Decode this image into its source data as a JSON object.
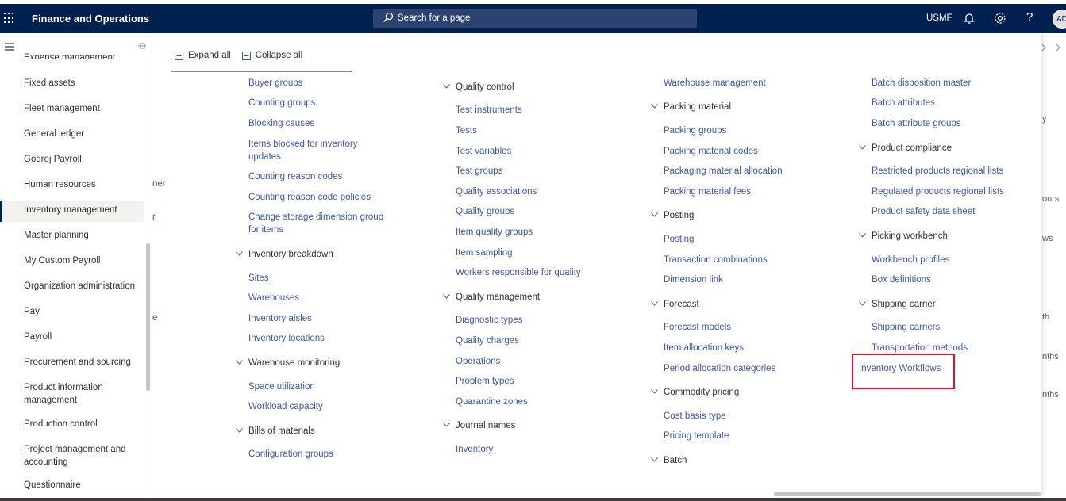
{
  "header": {
    "app_title": "Finance and Operations",
    "search_placeholder": "Search for a page",
    "company": "USMF",
    "help": "?",
    "avatar_initials": "AD"
  },
  "nav": {
    "items": [
      {
        "label": "Expense management"
      },
      {
        "label": "Fixed assets"
      },
      {
        "label": "Fleet management"
      },
      {
        "label": "General ledger"
      },
      {
        "label": "Godrej Payroll"
      },
      {
        "label": "Human resources"
      },
      {
        "label": "Inventory management"
      },
      {
        "label": "Master planning"
      },
      {
        "label": "My Custom Payroll"
      },
      {
        "label": "Organization administration"
      },
      {
        "label": "Pay"
      },
      {
        "label": "Payroll"
      },
      {
        "label": "Procurement and sourcing"
      },
      {
        "label": "Product information management"
      },
      {
        "label": "Production control"
      },
      {
        "label": "Project management and accounting"
      },
      {
        "label": "Questionnaire"
      }
    ]
  },
  "flyout": {
    "expand_all": "Expand all",
    "collapse_all": "Collapse all",
    "col1": {
      "links_top": [
        "Buyer groups",
        "Counting groups",
        "Blocking causes",
        "Items blocked for inventory updates",
        "Counting reason codes",
        "Counting reason code policies",
        "Change storage dimension group for items"
      ],
      "group_inventory_breakdown": "Inventory breakdown",
      "links_breakdown": [
        "Sites",
        "Warehouses",
        "Inventory aisles",
        "Inventory locations"
      ],
      "group_warehouse_monitoring": "Warehouse monitoring",
      "links_monitoring": [
        "Space utilization",
        "Workload capacity"
      ],
      "group_bom": "Bills of materials",
      "links_bom": [
        "Configuration groups"
      ]
    },
    "col2": {
      "group_quality_control": "Quality control",
      "links_qc": [
        "Test instruments",
        "Tests",
        "Test variables",
        "Test groups",
        "Quality associations",
        "Quality groups",
        "Item quality groups",
        "Item sampling",
        "Workers responsible for quality"
      ],
      "group_quality_management": "Quality management",
      "links_qm": [
        "Diagnostic types",
        "Quality charges",
        "Operations",
        "Problem types",
        "Quarantine zones"
      ],
      "group_journal_names": "Journal names",
      "links_journal": [
        "Inventory"
      ]
    },
    "col3": {
      "link_top": "Warehouse management",
      "group_packing": "Packing material",
      "links_packing": [
        "Packing groups",
        "Packing material codes",
        "Packaging material allocation",
        "Packing material fees"
      ],
      "group_posting": "Posting",
      "links_posting": [
        "Posting",
        "Transaction combinations",
        "Dimension link"
      ],
      "group_forecast": "Forecast",
      "links_forecast": [
        "Forecast models",
        "Item allocation keys",
        "Period allocation categories"
      ],
      "group_commodity": "Commodity pricing",
      "links_commodity": [
        "Cost basis type",
        "Pricing template"
      ],
      "group_batch": "Batch"
    },
    "col4": {
      "links_top": [
        "Batch disposition master",
        "Batch attributes",
        "Batch attribute groups"
      ],
      "group_compliance": "Product compliance",
      "links_compliance": [
        "Restricted products regional lists",
        "Regulated products regional lists",
        "Product safety data sheet"
      ],
      "group_picking": "Picking workbench",
      "links_picking": [
        "Workbench profiles",
        "Box definitions"
      ],
      "group_shipping": "Shipping carrier",
      "links_shipping": [
        "Shipping carriers",
        "Transportation methods"
      ],
      "highlighted_link": "Inventory Workflows"
    }
  },
  "background_fragments": {
    "left": [
      "ner",
      "r",
      "e"
    ],
    "right": [
      "y",
      "ours",
      "ws",
      "th",
      "nths",
      "nths"
    ]
  },
  "colors": {
    "topbar": "#002050",
    "link": "#3a55b4",
    "highlight": "#e81123"
  }
}
